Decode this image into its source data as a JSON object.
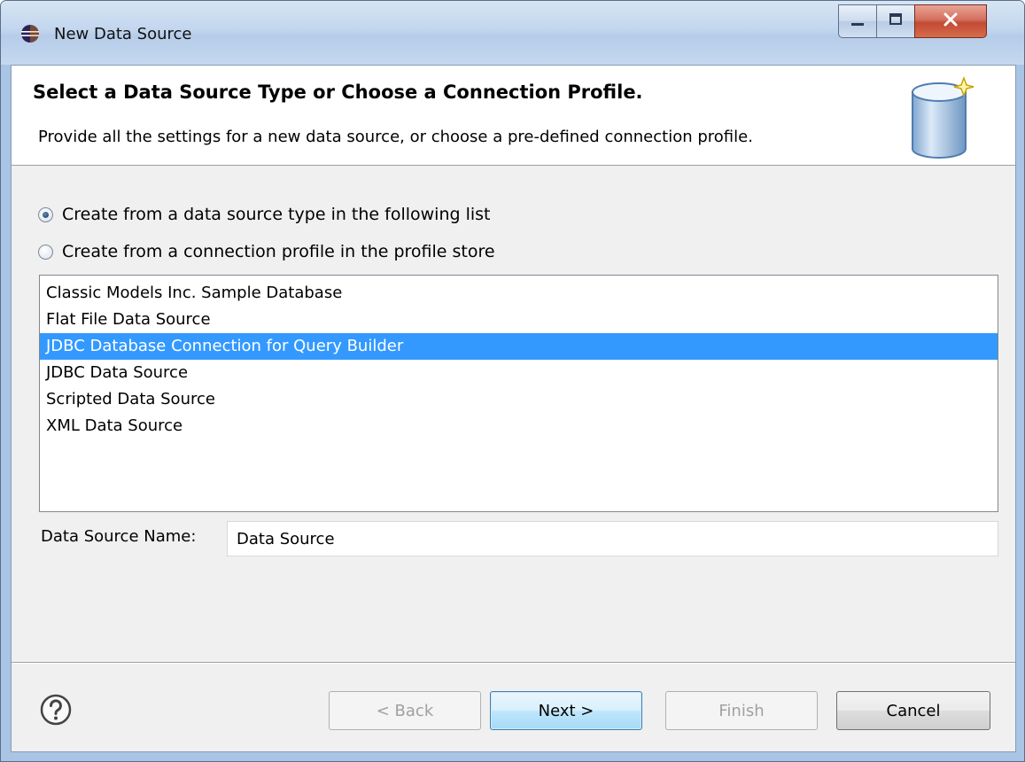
{
  "window": {
    "title": "New Data Source",
    "icon": "eclipse-icon",
    "controls": {
      "minimize": "minimize-icon",
      "maximize": "maximize-icon",
      "close": "close-icon"
    }
  },
  "header": {
    "title": "Select a Data Source Type or Choose a Connection Profile.",
    "description": "Provide all the settings for a new data source, or choose a pre-defined connection profile.",
    "image": "database-icon"
  },
  "options": {
    "from_type": {
      "label": "Create from a data source type in the following list",
      "selected": true
    },
    "from_profile": {
      "label": "Create from a connection profile in the profile store",
      "selected": false
    }
  },
  "data_source_types": {
    "items": [
      {
        "label": "Classic Models Inc. Sample Database",
        "selected": false
      },
      {
        "label": "Flat File Data Source",
        "selected": false
      },
      {
        "label": "JDBC Database Connection for Query Builder",
        "selected": true
      },
      {
        "label": "JDBC Data Source",
        "selected": false
      },
      {
        "label": "Scripted Data Source",
        "selected": false
      },
      {
        "label": "XML Data Source",
        "selected": false
      }
    ]
  },
  "name_field": {
    "label": "Data Source Name:",
    "value": "Data Source"
  },
  "footer": {
    "help_icon": "help-icon",
    "back_label": "< Back",
    "next_label": "Next >",
    "finish_label": "Finish",
    "cancel_label": "Cancel"
  },
  "colors": {
    "selection": "#3399ff",
    "default_button": "#3c7fb1"
  }
}
